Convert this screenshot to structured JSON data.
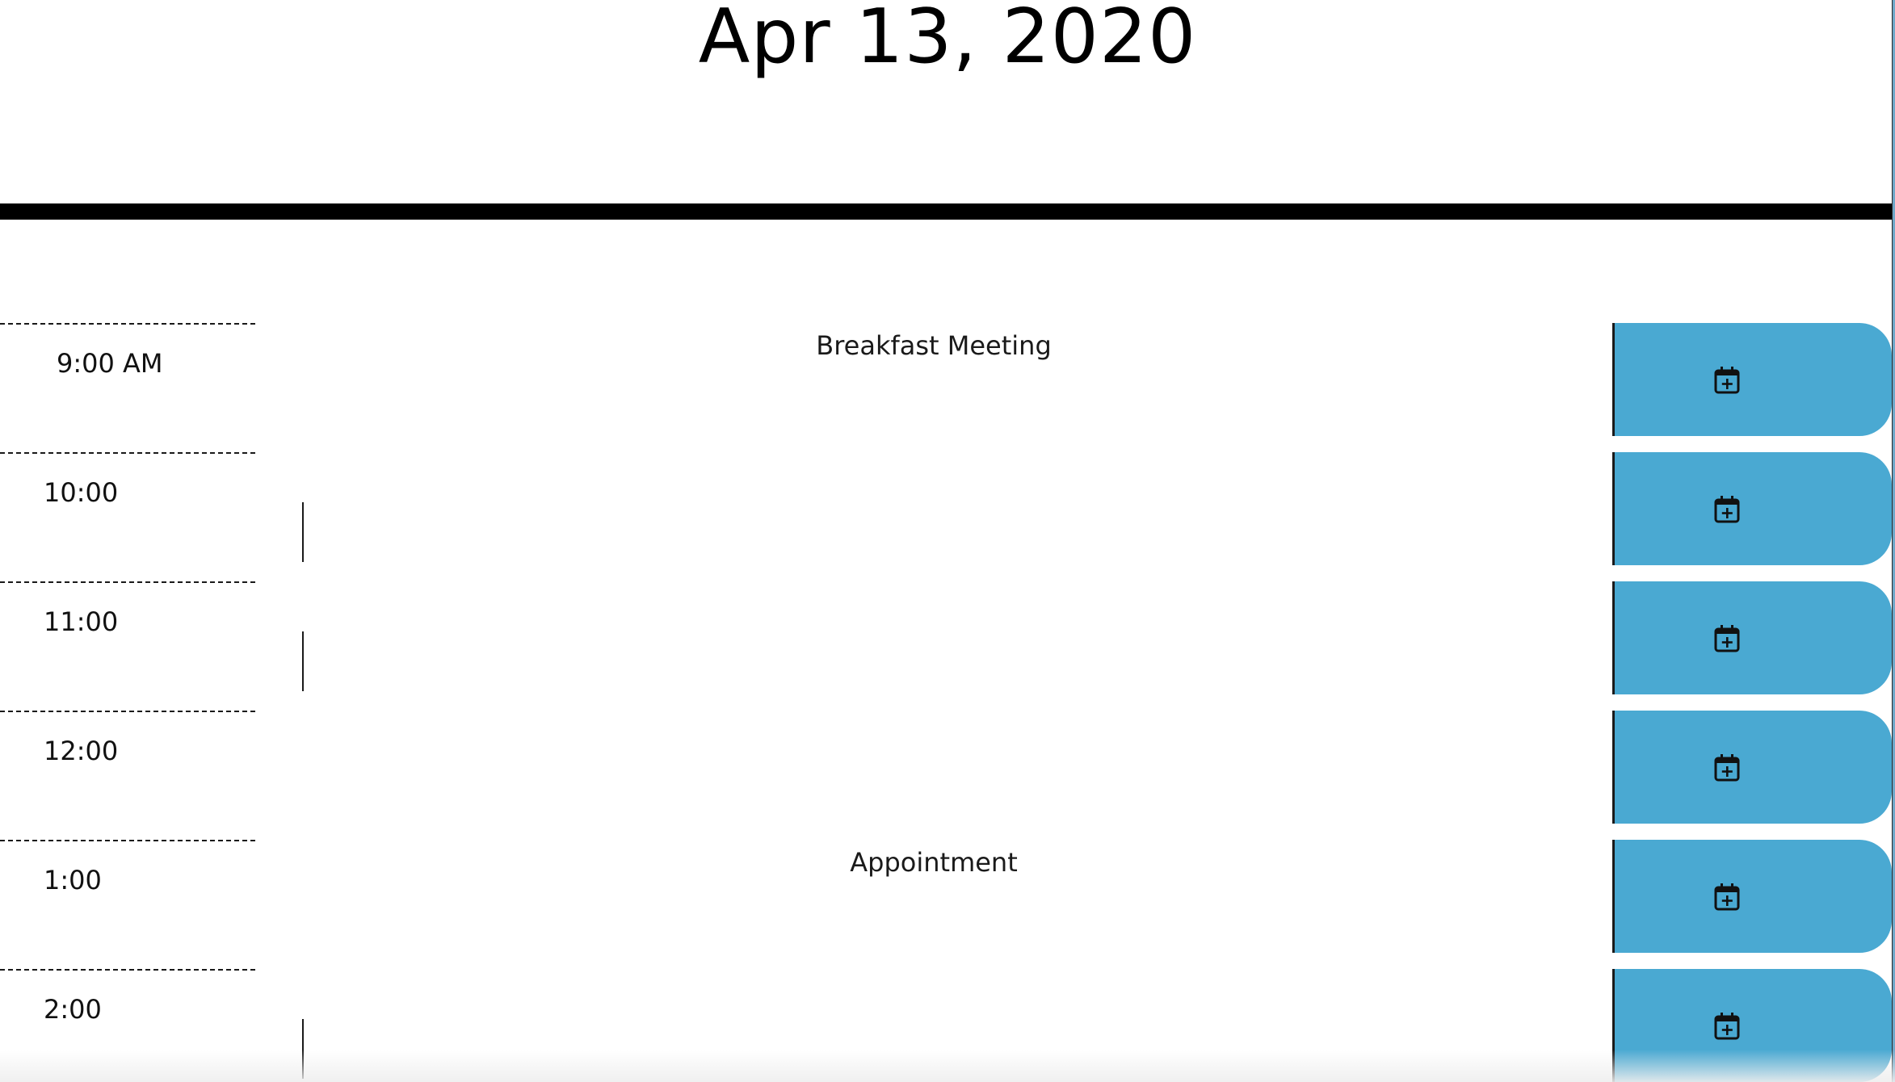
{
  "header": {
    "date": "Apr 13, 2020"
  },
  "colors": {
    "save_button": "#4aa9d2",
    "divider": "#000000"
  },
  "rows": [
    {
      "hour": "9:00 AM",
      "description": "Breakfast Meeting",
      "save_icon": "calendar-plus-icon"
    },
    {
      "hour": "10:00",
      "description": "",
      "save_icon": "calendar-plus-icon"
    },
    {
      "hour": "11:00",
      "description": "",
      "save_icon": "calendar-plus-icon"
    },
    {
      "hour": "12:00",
      "description": "",
      "save_icon": "calendar-plus-icon"
    },
    {
      "hour": "1:00",
      "description": "Appointment",
      "save_icon": "calendar-plus-icon"
    },
    {
      "hour": "2:00",
      "description": "",
      "save_icon": "calendar-plus-icon"
    }
  ]
}
